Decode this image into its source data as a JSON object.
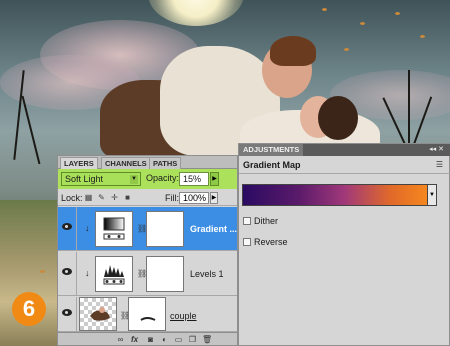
{
  "background": {
    "description_icons": [
      "moon",
      "trees",
      "falling-leaves",
      "couple"
    ]
  },
  "layers_panel": {
    "tabs": [
      "LAYERS",
      "CHANNELS",
      "PATHS"
    ],
    "active_tab": "LAYERS",
    "blend_mode": "Soft Light",
    "opacity_label": "Opacity:",
    "opacity_value": "15%",
    "lock_label": "Lock:",
    "fill_label": "Fill:",
    "fill_value": "100%",
    "highlight_color": "#ace15b",
    "selected_color": "#3b8ee4",
    "layers": [
      {
        "name": "Gradient ...",
        "selected": true,
        "clipped": true,
        "thumb": "gradient-map-adjustment-icon"
      },
      {
        "name": "Levels 1",
        "selected": false,
        "clipped": true,
        "thumb": "levels-adjustment-icon"
      },
      {
        "name": "couple",
        "selected": false,
        "clipped": false,
        "thumb": "transparent-image-thumbnail"
      }
    ],
    "bottom_icons": [
      "link-icon",
      "fx-icon",
      "mask-icon",
      "adjustment-icon",
      "group-icon",
      "new-layer-icon",
      "trash-icon"
    ]
  },
  "adjustments_panel": {
    "tab": "ADJUSTMENTS",
    "title": "Gradient Map",
    "gradient_colors": [
      "#2a0b62",
      "#f5871e"
    ],
    "dither_label": "Dither",
    "reverse_label": "Reverse",
    "dither_checked": false,
    "reverse_checked": false
  },
  "step_badge": {
    "number": "6",
    "color": "#f08a14"
  }
}
